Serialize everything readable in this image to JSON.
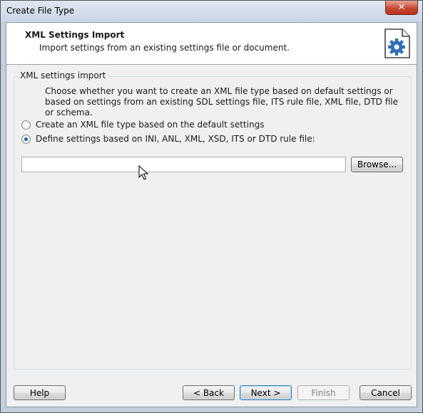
{
  "window": {
    "title": "Create File Type",
    "close_label": "✕"
  },
  "header": {
    "title": "XML Settings Import",
    "subtitle": "Import settings from an existing settings file or document.",
    "icon": "settings-document-icon"
  },
  "group": {
    "legend": "XML settings import",
    "description": "Choose whether you want to create an XML file type based on default settings or based on settings from an existing SDL settings file, ITS rule file, XML file, DTD file or schema.",
    "options": [
      {
        "label": "Create an XML file type based on the default settings",
        "checked": false
      },
      {
        "label": "Define settings based on INI, ANL, XML, XSD, ITS or DTD rule file:",
        "checked": true
      }
    ],
    "file_path": {
      "value": "",
      "placeholder": ""
    },
    "browse_label": "Browse..."
  },
  "footer": {
    "help_label": "Help",
    "back_label": "< Back",
    "next_label": "Next >",
    "finish_label": "Finish",
    "cancel_label": "Cancel"
  },
  "colors": {
    "accent": "#1d5fa8",
    "gear": "#2f6fb5"
  }
}
